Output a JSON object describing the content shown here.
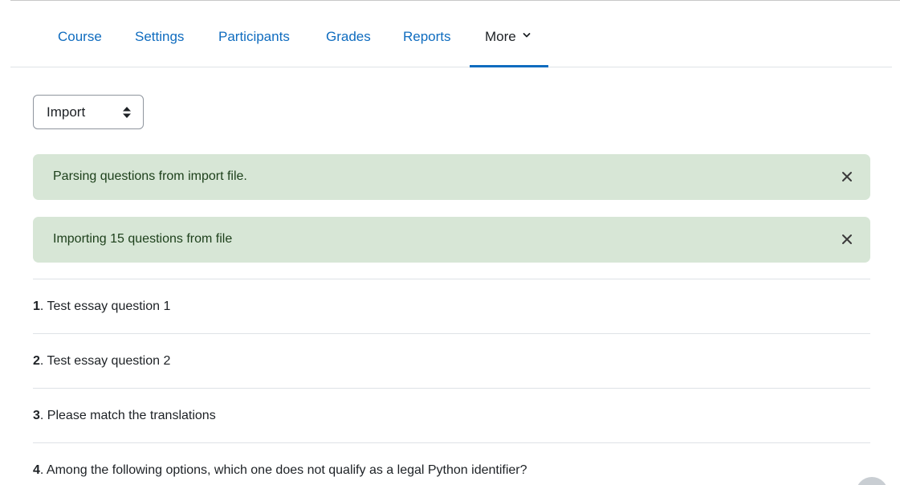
{
  "nav": {
    "items": [
      {
        "label": "Course"
      },
      {
        "label": "Settings"
      },
      {
        "label": "Participants"
      },
      {
        "label": "Grades"
      },
      {
        "label": "Reports"
      },
      {
        "label": "More"
      }
    ],
    "active": "More"
  },
  "action_select": {
    "value": "Import"
  },
  "alerts": [
    {
      "text": "Parsing questions from import file."
    },
    {
      "text": "Importing 15 questions from file"
    }
  ],
  "questions": [
    {
      "num": "1",
      "text": ". Test essay question 1"
    },
    {
      "num": "2",
      "text": ". Test essay question 2"
    },
    {
      "num": "3",
      "text": ". Please match the translations"
    },
    {
      "num": "4",
      "text": ". Among the following options, which one does not qualify as a legal Python identifier?"
    }
  ],
  "colors": {
    "link": "#0f6cbf",
    "alert_bg": "#d7e6d6",
    "alert_text": "#1c3f1a"
  }
}
